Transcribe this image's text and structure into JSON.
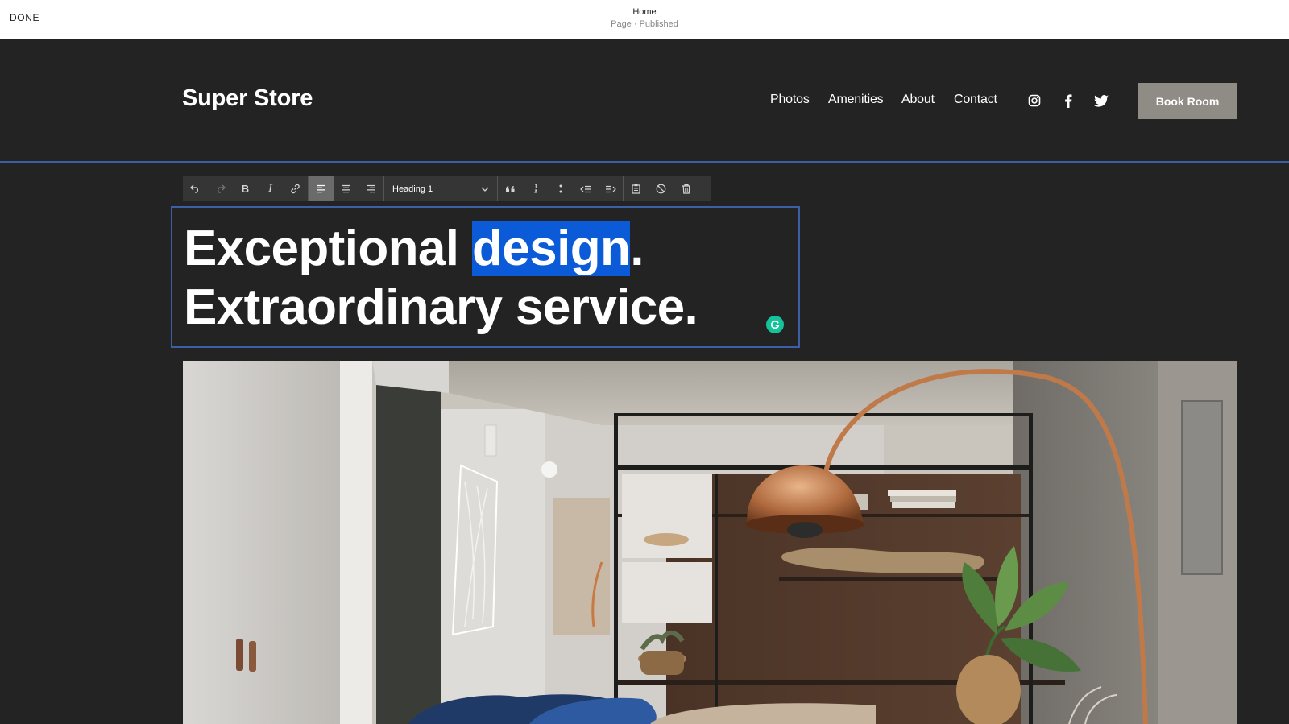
{
  "editor": {
    "done_label": "DONE",
    "page_name": "Home",
    "page_status": "Page · Published"
  },
  "site": {
    "title": "Super Store",
    "nav": [
      "Photos",
      "Amenities",
      "About",
      "Contact"
    ],
    "social_icons": [
      "instagram-icon",
      "facebook-icon",
      "twitter-icon"
    ],
    "cta_label": "Book Room"
  },
  "toolbar": {
    "buttons": [
      "undo-icon",
      "redo-icon",
      "bold-icon",
      "italic-icon",
      "link-icon",
      "align-left-icon",
      "align-center-icon",
      "align-right-icon",
      "quote-icon",
      "numbered-list-icon",
      "bullet-list-icon",
      "outdent-icon",
      "indent-icon",
      "paste-icon",
      "clear-format-icon",
      "delete-icon"
    ],
    "bold_glyph": "B",
    "italic_glyph": "I",
    "style_value": "Heading 1",
    "active_alignment": "left"
  },
  "content": {
    "line1_prefix": "Exceptional ",
    "line1_selected": "design",
    "line1_suffix": ".",
    "line2": "Extraordinary service."
  },
  "colors": {
    "background": "#232323",
    "selection": "#0b5bd8",
    "block_outline": "#3c5fa8",
    "cta": "#8f8c86",
    "grammarly": "#15c39a"
  }
}
